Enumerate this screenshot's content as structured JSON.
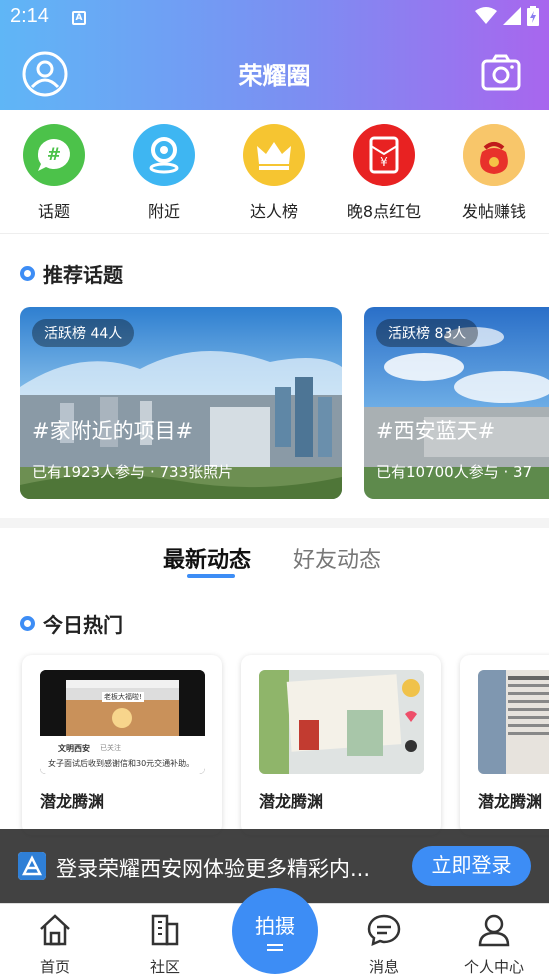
{
  "status_bar": {
    "time": "2:14",
    "a_icon": "A"
  },
  "header": {
    "title": "荣耀圈",
    "avatar_icon": "user-circle-icon",
    "camera_icon": "camera-icon"
  },
  "quick_menu": [
    {
      "label": "话题",
      "icon": "hash-chat-icon",
      "color": "#4cc24a"
    },
    {
      "label": "附近",
      "icon": "location-pin-icon",
      "color": "#3eb6f2"
    },
    {
      "label": "达人榜",
      "icon": "crown-icon",
      "color": "#f6c531"
    },
    {
      "label": "晚8点红包",
      "icon": "red-envelope-icon",
      "color": "#e82222"
    },
    {
      "label": "发帖赚钱",
      "icon": "money-bag-icon",
      "color": "#f5a623"
    }
  ],
  "recommend": {
    "title": "推荐话题",
    "topics": [
      {
        "badge": "活跃榜 44人",
        "name": "#家附近的项目#",
        "sub": "已有1923人参与 · 733张照片"
      },
      {
        "badge": "活跃榜 83人",
        "name": "#西安蓝天#",
        "sub": "已有10700人参与 · 37"
      }
    ]
  },
  "tabs": {
    "active": "最新动态",
    "inactive": "好友动态"
  },
  "hot": {
    "title": "今日热门",
    "posts": [
      {
        "name": "潜龙腾渊",
        "thumb_line1": "老板大福啦!",
        "thumb_account": "文明西安",
        "thumb_follow": "已关注",
        "thumb_caption": "女子面试后收到感谢信和30元交通补助。"
      },
      {
        "name": "潜龙腾渊"
      },
      {
        "name": "潜龙腾渊"
      }
    ]
  },
  "login_banner": {
    "text": "登录荣耀西安网体验更多精彩内...",
    "button": "立即登录"
  },
  "bottom_nav": {
    "home": "首页",
    "community": "社区",
    "shoot": "拍摄",
    "messages": "消息",
    "profile": "个人中心"
  },
  "colors": {
    "accent": "#3d8df5",
    "header_start": "#5fb6f6",
    "header_end": "#a866ee"
  }
}
